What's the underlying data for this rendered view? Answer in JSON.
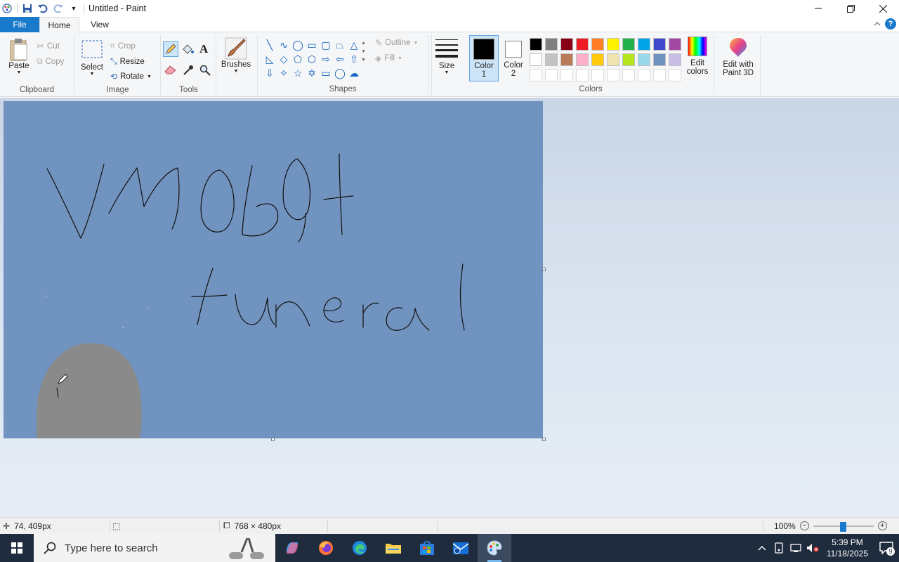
{
  "window": {
    "title": "Untitled - Paint"
  },
  "tabs": {
    "file": "File",
    "home": "Home",
    "view": "View"
  },
  "clipboard": {
    "paste": "Paste",
    "cut": "Cut",
    "copy": "Copy",
    "group": "Clipboard"
  },
  "image": {
    "select": "Select",
    "crop": "Crop",
    "resize": "Resize",
    "rotate": "Rotate",
    "group": "Image"
  },
  "tools": {
    "group": "Tools"
  },
  "brushes": {
    "label": "Brushes"
  },
  "shapes": {
    "outline": "Outline",
    "fill": "Fill",
    "group": "Shapes"
  },
  "size": {
    "label": "Size"
  },
  "colors": {
    "color1": "Color\n1",
    "color2": "Color\n2",
    "color1_value": "#000000",
    "color2_value": "#ffffff",
    "edit": "Edit\ncolors",
    "group": "Colors",
    "palette": [
      "#000000",
      "#7f7f7f",
      "#880015",
      "#ed1c24",
      "#ff7f27",
      "#fff200",
      "#22b14c",
      "#00a2e8",
      "#3f48cc",
      "#a349a4",
      "#ffffff",
      "#c3c3c3",
      "#b97a57",
      "#ffaec9",
      "#ffc90e",
      "#efe4b0",
      "#b5e61d",
      "#99d9ea",
      "#7092be",
      "#c8bfe7",
      "",
      "",
      "",
      "",
      "",
      "",
      "",
      "",
      "",
      ""
    ]
  },
  "paint3d": {
    "label": "Edit with\nPaint 3D"
  },
  "canvas": {
    "background": "#7193bf",
    "blob": "#8a8a8a"
  },
  "status": {
    "cursor": "74, 409px",
    "size": "768 × 480px",
    "zoom": "100%"
  },
  "taskbar": {
    "search_placeholder": "Type here to search",
    "time": "5:39 PM",
    "date": "11/18/2025"
  }
}
